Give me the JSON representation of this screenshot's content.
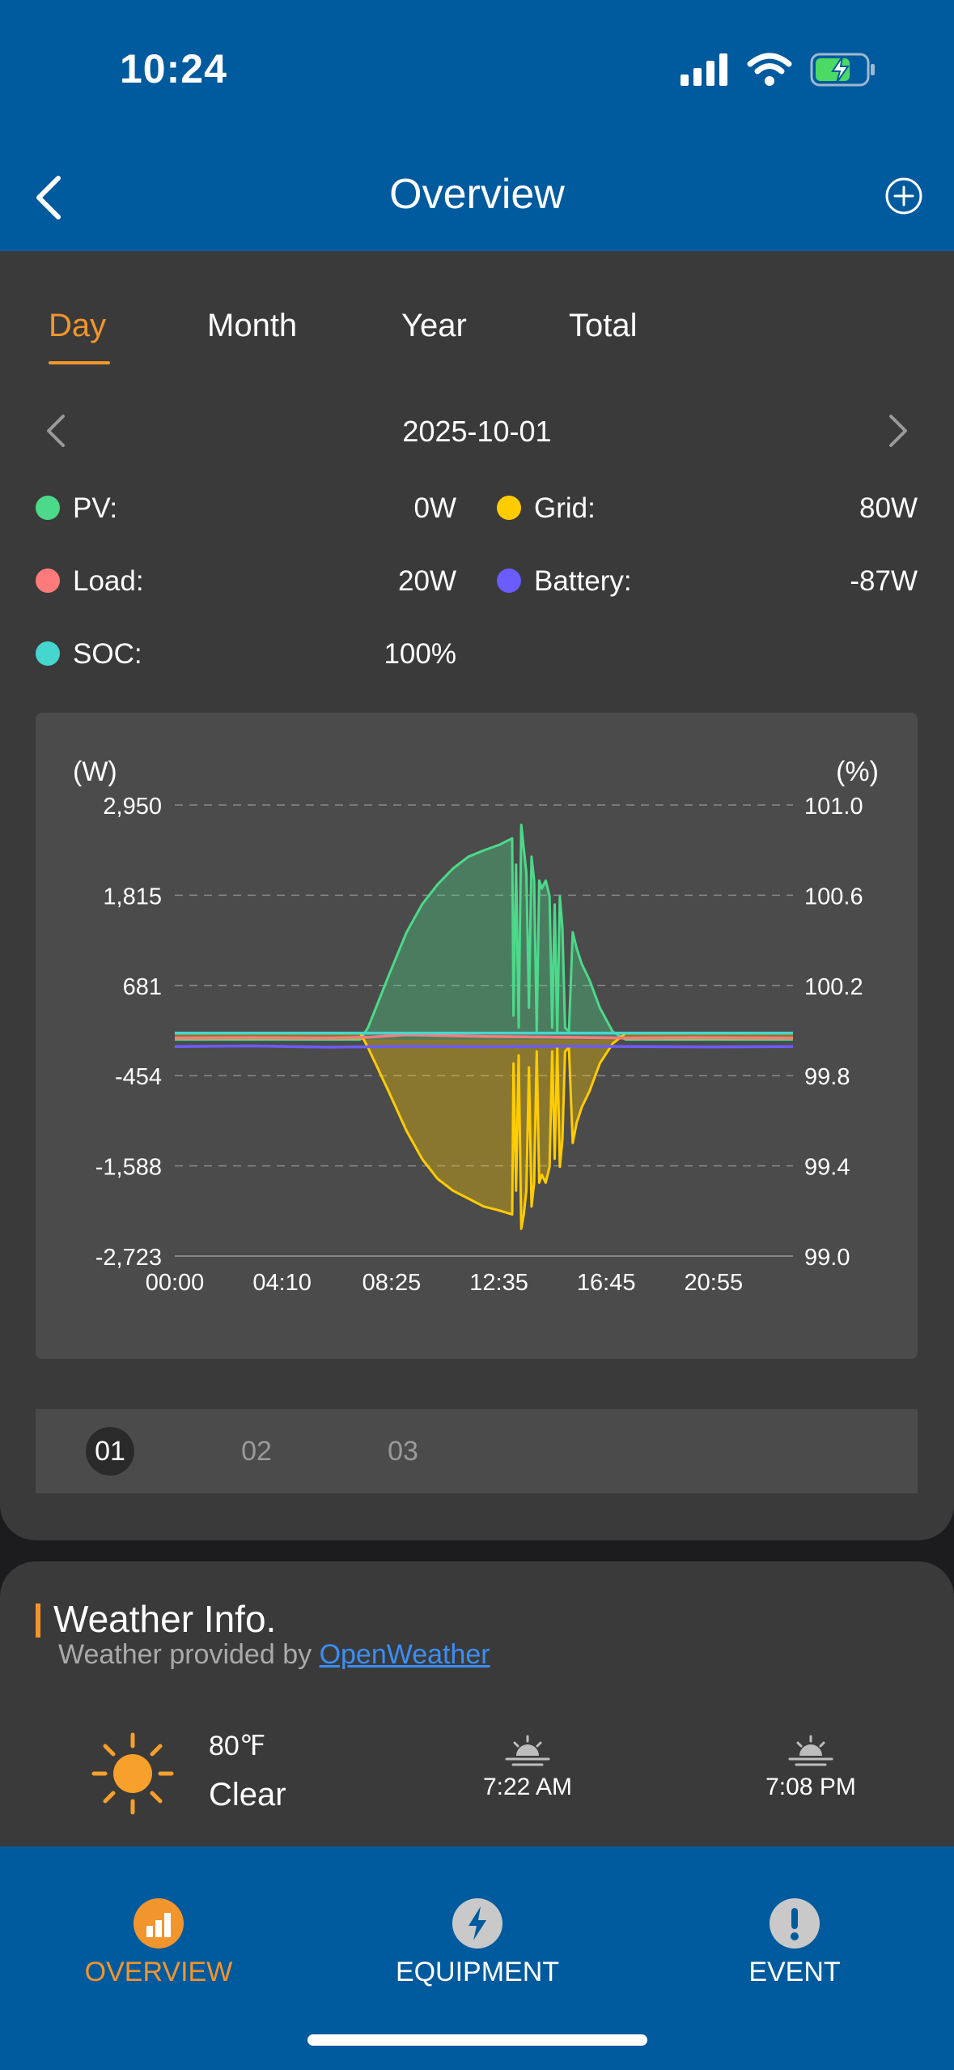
{
  "status_bar": {
    "time": "10:24"
  },
  "header": {
    "title": "Overview"
  },
  "tabs": [
    {
      "label": "Day",
      "active": true
    },
    {
      "label": "Month",
      "active": false
    },
    {
      "label": "Year",
      "active": false
    },
    {
      "label": "Total",
      "active": false
    }
  ],
  "date": "2025-10-01",
  "legend": [
    {
      "label": "PV:",
      "value": "0W",
      "color": "#4cd98a"
    },
    {
      "label": "Grid:",
      "value": "80W",
      "color": "#ffcc00"
    },
    {
      "label": "Load:",
      "value": "20W",
      "color": "#ff7b7b"
    },
    {
      "label": "Battery:",
      "value": "-87W",
      "color": "#6b5cff"
    },
    {
      "label": "SOC:",
      "value": "100%",
      "color": "#46d6d0"
    }
  ],
  "chart_data": {
    "type": "area",
    "left_unit": "(W)",
    "right_unit": "(%)",
    "y_left_ticks": [
      "2,950",
      "1,815",
      "681",
      "-454",
      "-1,588",
      "-2,723"
    ],
    "y_right_ticks": [
      "101.0",
      "100.6",
      "100.2",
      "99.8",
      "99.4",
      "99.0"
    ],
    "x_ticks": [
      "00:00",
      "04:10",
      "08:25",
      "12:35",
      "16:45",
      "20:55"
    ],
    "ylim_left": [
      -2723,
      2950
    ],
    "ylim_right": [
      99.0,
      101.0
    ],
    "xlim_hours": [
      0,
      24
    ],
    "grid": "dashed horizontal",
    "series": [
      {
        "name": "PV",
        "color": "#4cd98a",
        "x": [
          0,
          7.2,
          7.5,
          8.3,
          9.0,
          9.6,
          10.2,
          10.8,
          11.4,
          12.0,
          12.6,
          13.1,
          13.15,
          13.25,
          13.35,
          13.45,
          13.55,
          13.65,
          13.75,
          13.85,
          13.95,
          14.05,
          14.15,
          14.25,
          14.4,
          14.55,
          14.65,
          14.75,
          14.85,
          14.95,
          15.05,
          15.15,
          15.3,
          15.45,
          15.6,
          15.8,
          16.1,
          16.5,
          17.0,
          17.5,
          17.8,
          24
        ],
        "values": [
          0,
          0,
          150,
          800,
          1350,
          1700,
          1950,
          2150,
          2300,
          2380,
          2450,
          2530,
          300,
          2200,
          150,
          2700,
          2400,
          2100,
          400,
          2300,
          2000,
          100,
          2000,
          1900,
          2000,
          1800,
          150,
          1700,
          100,
          1800,
          1400,
          150,
          100,
          1350,
          1150,
          950,
          750,
          400,
          100,
          0,
          0,
          0
        ]
      },
      {
        "name": "Grid",
        "color": "#ffcc00",
        "x": [
          0,
          7.2,
          7.5,
          8.3,
          9.0,
          9.6,
          10.2,
          10.8,
          11.4,
          12.0,
          12.6,
          13.1,
          13.15,
          13.25,
          13.35,
          13.45,
          13.55,
          13.65,
          13.75,
          13.85,
          13.95,
          14.05,
          14.15,
          14.25,
          14.4,
          14.55,
          14.65,
          14.75,
          14.85,
          14.95,
          15.05,
          15.15,
          15.3,
          15.45,
          15.6,
          15.8,
          16.1,
          16.5,
          17.0,
          17.5,
          17.8,
          24
        ],
        "values": [
          80,
          80,
          -100,
          -650,
          -1150,
          -1500,
          -1750,
          -1900,
          -2000,
          -2100,
          -2150,
          -2200,
          -300,
          -1900,
          -200,
          -2380,
          -2200,
          -1900,
          -350,
          -2100,
          -1800,
          -150,
          -1800,
          -1700,
          -1800,
          -1600,
          -150,
          -1500,
          -100,
          -1600,
          -1250,
          -150,
          -100,
          -1300,
          -1050,
          -850,
          -650,
          -300,
          -50,
          80,
          80,
          80
        ]
      },
      {
        "name": "Load",
        "color": "#ff7b7b",
        "x": [
          0,
          3,
          6,
          7.5,
          9,
          12,
          15,
          17.5,
          20,
          24
        ],
        "values": [
          20,
          25,
          20,
          30,
          60,
          40,
          30,
          20,
          25,
          20
        ]
      },
      {
        "name": "Battery",
        "color": "#6b5cff",
        "x": [
          0,
          3,
          6,
          9,
          12,
          15,
          18,
          21,
          24
        ],
        "values": [
          -87,
          -80,
          -95,
          -85,
          -90,
          -82,
          -88,
          -92,
          -87
        ]
      },
      {
        "name": "SOC",
        "color": "#46d6d0",
        "axis": "right",
        "x": [
          0,
          24
        ],
        "values": [
          100,
          100
        ]
      }
    ]
  },
  "pager": [
    "01",
    "02",
    "03"
  ],
  "weather": {
    "title": "Weather Info.",
    "provided_prefix": "Weather provided by ",
    "provider": "OpenWeather",
    "temperature": "80℉",
    "condition": "Clear",
    "sunrise": "7:22 AM",
    "sunset": "7:08 PM"
  },
  "bottom_nav": [
    {
      "label": "OVERVIEW",
      "icon": "chart-icon",
      "active": true
    },
    {
      "label": "EQUIPMENT",
      "icon": "lightning-icon",
      "active": false
    },
    {
      "label": "EVENT",
      "icon": "alert-icon",
      "active": false
    }
  ]
}
